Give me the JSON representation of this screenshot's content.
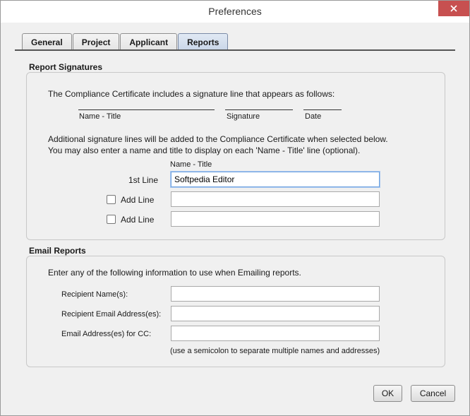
{
  "window": {
    "title": "Preferences"
  },
  "tabs": [
    {
      "label": "General"
    },
    {
      "label": "Project"
    },
    {
      "label": "Applicant"
    },
    {
      "label": "Reports"
    }
  ],
  "active_tab": "Reports",
  "report_signatures": {
    "heading": "Report Signatures",
    "intro": "The Compliance Certificate includes a signature line that appears as follows:",
    "sample_labels": {
      "name_title": "Name - Title",
      "signature": "Signature",
      "date": "Date"
    },
    "additional_1": "Additional signature lines will be added to the Compliance Certificate when selected below.",
    "additional_2": "You may also enter a name and title to display on each 'Name - Title' line (optional).",
    "column_header": "Name - Title",
    "first_line_label": "1st Line",
    "first_line_value": "Softpedia Editor",
    "add_line_1_label": "Add Line",
    "add_line_2_label": "Add Line"
  },
  "email_reports": {
    "heading": "Email Reports",
    "intro": "Enter any of the following information to use when Emailing reports.",
    "recipient_names_label": "Recipient Name(s):",
    "recipient_emails_label": "Recipient Email Address(es):",
    "cc_label": "Email Address(es) for CC:",
    "hint": "(use a semicolon to separate multiple names and addresses)"
  },
  "buttons": {
    "ok": "OK",
    "cancel": "Cancel"
  }
}
